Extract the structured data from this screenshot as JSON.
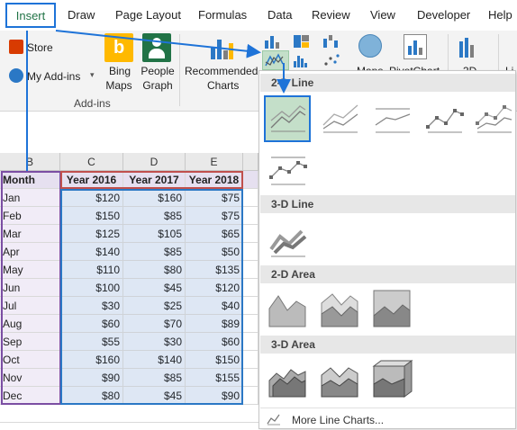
{
  "tabs": [
    "Insert",
    "Draw",
    "Page Layout",
    "Formulas",
    "Data",
    "Review",
    "View",
    "Developer",
    "Help"
  ],
  "ribbon": {
    "store": "Store",
    "my_addins": "My Add-ins",
    "bing_maps_1": "Bing",
    "bing_maps_2": "Maps",
    "people_graph_1": "People",
    "people_graph_2": "Graph",
    "group_addins": "Add-ins",
    "recommended_1": "Recommended",
    "recommended_2": "Charts",
    "maps": "Maps",
    "pivotchart": "PivotChart",
    "threed": "3D",
    "li": "Li"
  },
  "sheet": {
    "columns": [
      "B",
      "C",
      "D",
      "E"
    ],
    "headers": [
      "Month",
      "Year 2016",
      "Year 2017",
      "Year 2018"
    ],
    "rows": [
      [
        "Jan",
        "$120",
        "$160",
        "$75"
      ],
      [
        "Feb",
        "$150",
        "$85",
        "$75"
      ],
      [
        "Mar",
        "$125",
        "$105",
        "$65"
      ],
      [
        "Apr",
        "$140",
        "$85",
        "$50"
      ],
      [
        "May",
        "$110",
        "$80",
        "$135"
      ],
      [
        "Jun",
        "$100",
        "$45",
        "$120"
      ],
      [
        "Jul",
        "$30",
        "$25",
        "$40"
      ],
      [
        "Aug",
        "$60",
        "$70",
        "$89"
      ],
      [
        "Sep",
        "$55",
        "$30",
        "$60"
      ],
      [
        "Oct",
        "$160",
        "$140",
        "$150"
      ],
      [
        "Nov",
        "$90",
        "$85",
        "$155"
      ],
      [
        "Dec",
        "$80",
        "$45",
        "$90"
      ]
    ]
  },
  "menu": {
    "sections": [
      "2-D Line",
      "3-D Line",
      "2-D Area",
      "3-D Area"
    ],
    "more": "More Line Charts..."
  },
  "colors": {
    "accent_blue": "#1e73d8",
    "excel_green": "#217346",
    "selection_purple": "#7b4ea3",
    "selection_red": "#c0504d"
  }
}
